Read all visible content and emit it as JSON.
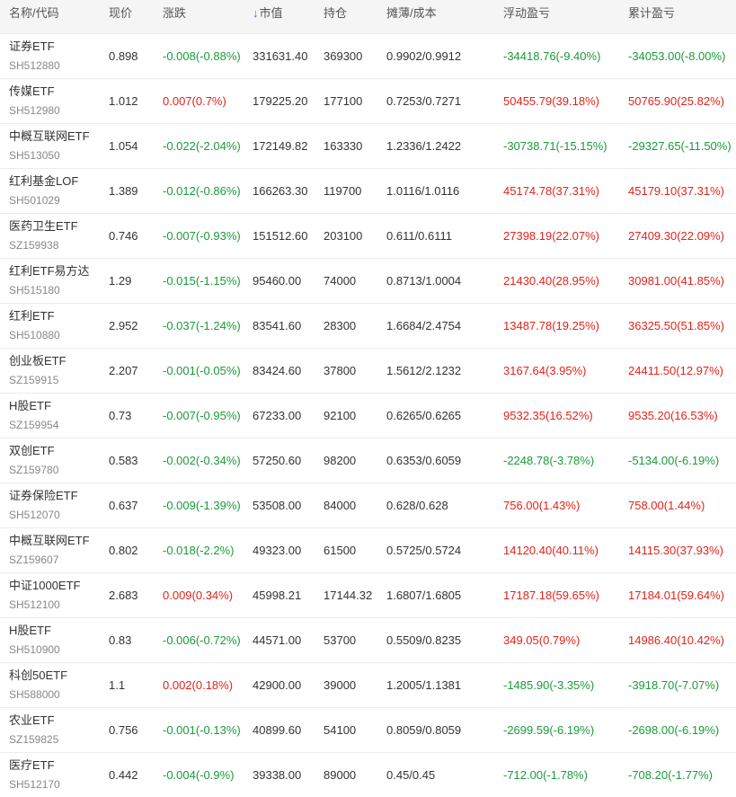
{
  "colors": {
    "up": "#e2231a",
    "down": "#1a9b3a",
    "header_bg": "#f5f5f5",
    "sort_icon": "#2b7bd6"
  },
  "header": {
    "name_code": "名称/代码",
    "price": "现价",
    "change": "涨跌",
    "sort_icon": "arrow-down-icon",
    "market_value": "市值",
    "holding": "持仓",
    "cost": "摊薄/成本",
    "floating_pl": "浮动盈亏",
    "cumulative_pl": "累计盈亏"
  },
  "rows": [
    {
      "name": "证券ETF",
      "code": "SH512880",
      "price": "0.898",
      "change": "-0.008(-0.88%)",
      "change_dir": "down",
      "market_value": "331631.40",
      "holding": "369300",
      "cost": "0.9902/0.9912",
      "floating": "-34418.76(-9.40%)",
      "floating_dir": "down",
      "cumulative": "-34053.00(-8.00%)",
      "cumulative_dir": "down"
    },
    {
      "name": "传媒ETF",
      "code": "SH512980",
      "price": "1.012",
      "change": "0.007(0.7%)",
      "change_dir": "up",
      "market_value": "179225.20",
      "holding": "177100",
      "cost": "0.7253/0.7271",
      "floating": "50455.79(39.18%)",
      "floating_dir": "up",
      "cumulative": "50765.90(25.82%)",
      "cumulative_dir": "up"
    },
    {
      "name": "中概互联网ETF",
      "code": "SH513050",
      "price": "1.054",
      "change": "-0.022(-2.04%)",
      "change_dir": "down",
      "market_value": "172149.82",
      "holding": "163330",
      "cost": "1.2336/1.2422",
      "floating": "-30738.71(-15.15%)",
      "floating_dir": "down",
      "cumulative": "-29327.65(-11.50%)",
      "cumulative_dir": "down"
    },
    {
      "name": "红利基金LOF",
      "code": "SH501029",
      "price": "1.389",
      "change": "-0.012(-0.86%)",
      "change_dir": "down",
      "market_value": "166263.30",
      "holding": "119700",
      "cost": "1.0116/1.0116",
      "floating": "45174.78(37.31%)",
      "floating_dir": "up",
      "cumulative": "45179.10(37.31%)",
      "cumulative_dir": "up"
    },
    {
      "name": "医药卫生ETF",
      "code": "SZ159938",
      "price": "0.746",
      "change": "-0.007(-0.93%)",
      "change_dir": "down",
      "market_value": "151512.60",
      "holding": "203100",
      "cost": "0.611/0.6111",
      "floating": "27398.19(22.07%)",
      "floating_dir": "up",
      "cumulative": "27409.30(22.09%)",
      "cumulative_dir": "up"
    },
    {
      "name": "红利ETF易方达",
      "code": "SH515180",
      "price": "1.29",
      "change": "-0.015(-1.15%)",
      "change_dir": "down",
      "market_value": "95460.00",
      "holding": "74000",
      "cost": "0.8713/1.0004",
      "floating": "21430.40(28.95%)",
      "floating_dir": "up",
      "cumulative": "30981.00(41.85%)",
      "cumulative_dir": "up"
    },
    {
      "name": "红利ETF",
      "code": "SH510880",
      "price": "2.952",
      "change": "-0.037(-1.24%)",
      "change_dir": "down",
      "market_value": "83541.60",
      "holding": "28300",
      "cost": "1.6684/2.4754",
      "floating": "13487.78(19.25%)",
      "floating_dir": "up",
      "cumulative": "36325.50(51.85%)",
      "cumulative_dir": "up"
    },
    {
      "name": "创业板ETF",
      "code": "SZ159915",
      "price": "2.207",
      "change": "-0.001(-0.05%)",
      "change_dir": "down",
      "market_value": "83424.60",
      "holding": "37800",
      "cost": "1.5612/2.1232",
      "floating": "3167.64(3.95%)",
      "floating_dir": "up",
      "cumulative": "24411.50(12.97%)",
      "cumulative_dir": "up"
    },
    {
      "name": "H股ETF",
      "code": "SZ159954",
      "price": "0.73",
      "change": "-0.007(-0.95%)",
      "change_dir": "down",
      "market_value": "67233.00",
      "holding": "92100",
      "cost": "0.6265/0.6265",
      "floating": "9532.35(16.52%)",
      "floating_dir": "up",
      "cumulative": "9535.20(16.53%)",
      "cumulative_dir": "up"
    },
    {
      "name": "双创ETF",
      "code": "SZ159780",
      "price": "0.583",
      "change": "-0.002(-0.34%)",
      "change_dir": "down",
      "market_value": "57250.60",
      "holding": "98200",
      "cost": "0.6353/0.6059",
      "floating": "-2248.78(-3.78%)",
      "floating_dir": "down",
      "cumulative": "-5134.00(-6.19%)",
      "cumulative_dir": "down"
    },
    {
      "name": "证券保险ETF",
      "code": "SH512070",
      "price": "0.637",
      "change": "-0.009(-1.39%)",
      "change_dir": "down",
      "market_value": "53508.00",
      "holding": "84000",
      "cost": "0.628/0.628",
      "floating": "756.00(1.43%)",
      "floating_dir": "up",
      "cumulative": "758.00(1.44%)",
      "cumulative_dir": "up"
    },
    {
      "name": "中概互联网ETF",
      "code": "SZ159607",
      "price": "0.802",
      "change": "-0.018(-2.2%)",
      "change_dir": "down",
      "market_value": "49323.00",
      "holding": "61500",
      "cost": "0.5725/0.5724",
      "floating": "14120.40(40.11%)",
      "floating_dir": "up",
      "cumulative": "14115.30(37.93%)",
      "cumulative_dir": "up"
    },
    {
      "name": "中证1000ETF",
      "code": "SH512100",
      "price": "2.683",
      "change": "0.009(0.34%)",
      "change_dir": "up",
      "market_value": "45998.21",
      "holding": "17144.32",
      "cost": "1.6807/1.6805",
      "floating": "17187.18(59.65%)",
      "floating_dir": "up",
      "cumulative": "17184.01(59.64%)",
      "cumulative_dir": "up"
    },
    {
      "name": "H股ETF",
      "code": "SH510900",
      "price": "0.83",
      "change": "-0.006(-0.72%)",
      "change_dir": "down",
      "market_value": "44571.00",
      "holding": "53700",
      "cost": "0.5509/0.8235",
      "floating": "349.05(0.79%)",
      "floating_dir": "up",
      "cumulative": "14986.40(10.42%)",
      "cumulative_dir": "up"
    },
    {
      "name": "科创50ETF",
      "code": "SH588000",
      "price": "1.1",
      "change": "0.002(0.18%)",
      "change_dir": "up",
      "market_value": "42900.00",
      "holding": "39000",
      "cost": "1.2005/1.1381",
      "floating": "-1485.90(-3.35%)",
      "floating_dir": "down",
      "cumulative": "-3918.70(-7.07%)",
      "cumulative_dir": "down"
    },
    {
      "name": "农业ETF",
      "code": "SZ159825",
      "price": "0.756",
      "change": "-0.001(-0.13%)",
      "change_dir": "down",
      "market_value": "40899.60",
      "holding": "54100",
      "cost": "0.8059/0.8059",
      "floating": "-2699.59(-6.19%)",
      "floating_dir": "down",
      "cumulative": "-2698.00(-6.19%)",
      "cumulative_dir": "down"
    },
    {
      "name": "医疗ETF",
      "code": "SH512170",
      "price": "0.442",
      "change": "-0.004(-0.9%)",
      "change_dir": "down",
      "market_value": "39338.00",
      "holding": "89000",
      "cost": "0.45/0.45",
      "floating": "-712.00(-1.78%)",
      "floating_dir": "down",
      "cumulative": "-708.20(-1.77%)",
      "cumulative_dir": "down"
    }
  ]
}
